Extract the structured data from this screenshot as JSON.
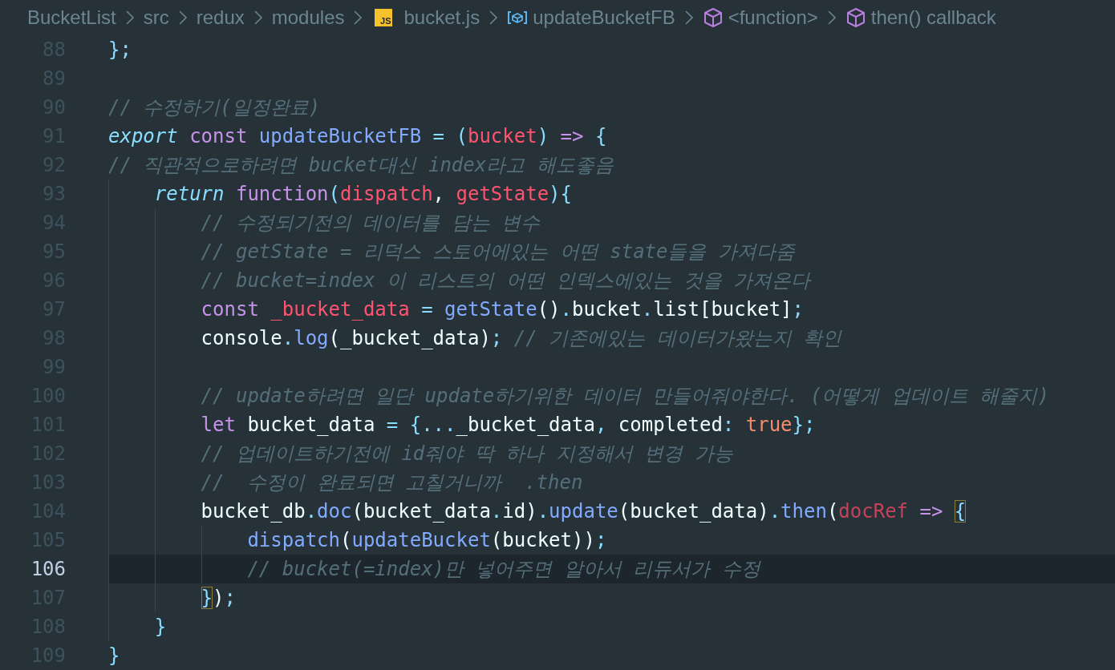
{
  "breadcrumb": [
    {
      "label": "BucketList",
      "kind": "folder"
    },
    {
      "label": "src",
      "kind": "folder"
    },
    {
      "label": "redux",
      "kind": "folder"
    },
    {
      "label": "modules",
      "kind": "folder"
    },
    {
      "label": "bucket.js",
      "kind": "js_file",
      "icon_text": "JS"
    },
    {
      "label": "updateBucketFB",
      "kind": "variable"
    },
    {
      "label": "<function>",
      "kind": "function"
    },
    {
      "label": "then() callback",
      "kind": "function"
    }
  ],
  "lines": [
    {
      "number": "88",
      "active": false,
      "tokens": [
        {
          "text": "};",
          "kind": "o"
        }
      ]
    },
    {
      "number": "89",
      "active": false
    },
    {
      "number": "90",
      "active": false,
      "tokens": [
        {
          "text": "// 수정하기(일정완료)",
          "kind": "c"
        }
      ]
    },
    {
      "number": "91",
      "active": false,
      "tokens": [
        {
          "text": "export",
          "kind": "ki"
        },
        {
          "text": " const",
          "kind": "k"
        },
        {
          "text": " updateBucketFB",
          "kind": "f"
        },
        {
          "text": " = (",
          "kind": "o"
        },
        {
          "text": "bucket",
          "kind": "a"
        },
        {
          "text": ") ",
          "kind": "o"
        },
        {
          "text": "=>",
          "kind": "k"
        },
        {
          "text": " {",
          "kind": "o"
        }
      ]
    },
    {
      "number": "92",
      "active": false,
      "tokens": [
        {
          "text": "// 직관적으로하려면 bucket대신 index라고 해도좋음",
          "kind": "c"
        }
      ]
    },
    {
      "number": "93",
      "active": false,
      "tokens": [
        {
          "text": "    return",
          "kind": "ki"
        },
        {
          "text": " function",
          "kind": "k"
        },
        {
          "text": "(",
          "kind": "o"
        },
        {
          "text": "dispatch",
          "kind": "a"
        },
        {
          "text": ", ",
          "kind": "p"
        },
        {
          "text": "getState",
          "kind": "a"
        },
        {
          "text": "){",
          "kind": "o"
        }
      ]
    },
    {
      "number": "94",
      "active": false,
      "tokens": [
        {
          "text": "        // 수정되기전의 데이터를 담는 변수",
          "kind": "c"
        }
      ]
    },
    {
      "number": "95",
      "active": false,
      "tokens": [
        {
          "text": "        // getState = 리덕스 스토어에있는 어떤 state들을 가져다줌",
          "kind": "c"
        }
      ]
    },
    {
      "number": "96",
      "active": false,
      "tokens": [
        {
          "text": "        // bucket=index 이 리스트의 어떤 인덱스에있는 것을 가져온다",
          "kind": "c"
        }
      ]
    },
    {
      "number": "97",
      "active": false,
      "tokens": [
        {
          "text": "        const",
          "kind": "k"
        },
        {
          "text": " _bucket_data",
          "kind": "a"
        },
        {
          "text": " = ",
          "kind": "o"
        },
        {
          "text": "getState",
          "kind": "f"
        },
        {
          "text": "()",
          "kind": "p"
        },
        {
          "text": ".",
          "kind": "o"
        },
        {
          "text": "bucket",
          "kind": "p"
        },
        {
          "text": ".",
          "kind": "o"
        },
        {
          "text": "list[bucket]",
          "kind": "p"
        },
        {
          "text": ";",
          "kind": "o"
        }
      ]
    },
    {
      "number": "98",
      "active": false,
      "tokens": [
        {
          "text": "        console",
          "kind": "p"
        },
        {
          "text": ".",
          "kind": "o"
        },
        {
          "text": "log",
          "kind": "f"
        },
        {
          "text": "(_bucket_data)",
          "kind": "p"
        },
        {
          "text": ";",
          "kind": "o"
        },
        {
          "text": " // 기존에있는 데이터가왔는지 확인",
          "kind": "c"
        }
      ]
    },
    {
      "number": "99",
      "active": false
    },
    {
      "number": "100",
      "active": false,
      "tokens": [
        {
          "text": "        // update하려면 일단 update하기위한 데이터 만들어줘야한다. (어떻게 업데이트 해줄지)",
          "kind": "c"
        }
      ]
    },
    {
      "number": "101",
      "active": false,
      "tokens": [
        {
          "text": "        let",
          "kind": "k"
        },
        {
          "text": " bucket_data ",
          "kind": "p"
        },
        {
          "text": "= {...",
          "kind": "o"
        },
        {
          "text": "_bucket_data",
          "kind": "p"
        },
        {
          "text": ",",
          "kind": "o"
        },
        {
          "text": " completed",
          "kind": "p"
        },
        {
          "text": ": ",
          "kind": "o"
        },
        {
          "text": "true",
          "kind": "b"
        },
        {
          "text": "};",
          "kind": "o"
        }
      ]
    },
    {
      "number": "102",
      "active": false,
      "tokens": [
        {
          "text": "        // 업데이트하기전에 id줘야 딱 하나 지정해서 변경 가능",
          "kind": "c"
        }
      ]
    },
    {
      "number": "103",
      "active": false,
      "tokens": [
        {
          "text": "        //  수정이 완료되면 고칠거니까  .then",
          "kind": "c"
        }
      ]
    },
    {
      "number": "104",
      "active": false,
      "tokens": [
        {
          "text": "        bucket_db",
          "kind": "p"
        },
        {
          "text": ".",
          "kind": "o"
        },
        {
          "text": "doc",
          "kind": "f"
        },
        {
          "text": "(bucket_data",
          "kind": "p"
        },
        {
          "text": ".",
          "kind": "o"
        },
        {
          "text": "id)",
          "kind": "p"
        },
        {
          "text": ".",
          "kind": "o"
        },
        {
          "text": "update",
          "kind": "f"
        },
        {
          "text": "(bucket_data)",
          "kind": "p"
        },
        {
          "text": ".",
          "kind": "o"
        },
        {
          "text": "then",
          "kind": "f"
        },
        {
          "text": "(",
          "kind": "p"
        },
        {
          "text": "docRef",
          "kind": "d"
        },
        {
          "text": " => ",
          "kind": "k"
        },
        {
          "text": "{",
          "kind": "o",
          "matched": true
        }
      ]
    },
    {
      "number": "105",
      "active": false,
      "tokens": [
        {
          "text": "            dispatch",
          "kind": "f"
        },
        {
          "text": "(",
          "kind": "p"
        },
        {
          "text": "updateBucket",
          "kind": "f"
        },
        {
          "text": "(bucket))",
          "kind": "p"
        },
        {
          "text": ";",
          "kind": "o"
        }
      ]
    },
    {
      "number": "106",
      "active": true,
      "tokens": [
        {
          "text": "            // bucket(=index)만 넣어주면 알아서 리듀서가 수정",
          "kind": "c"
        }
      ]
    },
    {
      "number": "107",
      "active": false,
      "tokens": [
        {
          "text": "        }",
          "kind": "o",
          "matched": true
        },
        {
          "text": ")",
          "kind": "p"
        },
        {
          "text": ";",
          "kind": "o"
        }
      ]
    },
    {
      "number": "108",
      "active": false,
      "tokens": [
        {
          "text": "    }",
          "kind": "o"
        }
      ]
    },
    {
      "number": "109",
      "active": false,
      "tokens": [
        {
          "text": "}",
          "kind": "o"
        }
      ]
    }
  ]
}
